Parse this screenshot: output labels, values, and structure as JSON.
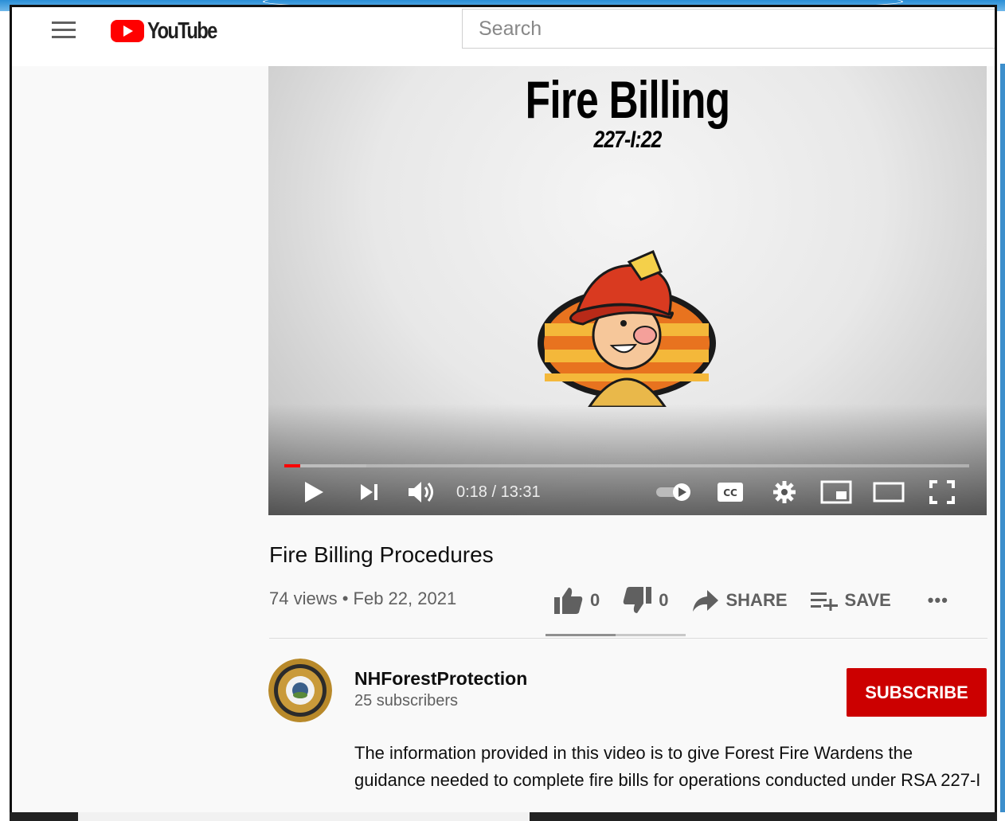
{
  "masthead": {
    "logo_text": "YouTube",
    "search_placeholder": "Search"
  },
  "player": {
    "slide_title": "Fire Billing",
    "slide_subtitle": "227-I:22",
    "time_display": "0:18 / 13:31",
    "progress_fraction": 0.023,
    "buffered_fraction": 0.12,
    "icons": [
      "play-icon",
      "next-icon",
      "volume-icon",
      "autoplay-toggle",
      "cc-icon",
      "settings-icon",
      "miniplayer-icon",
      "theater-icon",
      "fullscreen-icon"
    ]
  },
  "video": {
    "title": "Fire Billing Procedures",
    "view_info": "74 views • Feb 22, 2021",
    "likes": "0",
    "dislikes": "0",
    "share_label": "SHARE",
    "save_label": "SAVE",
    "more_label": "•••"
  },
  "channel": {
    "name": "NHForestProtection",
    "subscribers": "25 subscribers",
    "subscribe_label": "SUBSCRIBE"
  },
  "description": "The information provided in this video is to give Forest Fire Wardens the guidance needed to complete fire bills for operations conducted under RSA 227-I",
  "colors": {
    "brand_red": "#ff0000",
    "subscribe_red": "#cc0000",
    "frame_blue": "#2a8fd6"
  }
}
